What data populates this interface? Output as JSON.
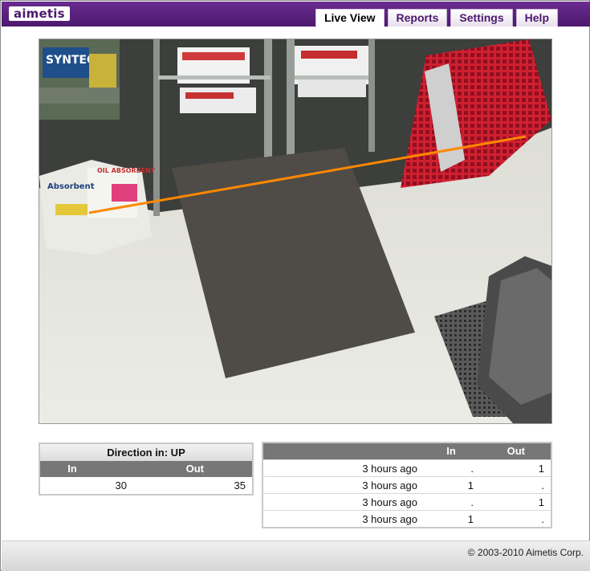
{
  "app": {
    "logo_text": "aimetis",
    "brand_color": "#4d1a6e"
  },
  "nav": {
    "tabs": [
      {
        "label": "Live View",
        "active": true
      },
      {
        "label": "Reports",
        "active": false
      },
      {
        "label": "Settings",
        "active": false
      },
      {
        "label": "Help",
        "active": false
      }
    ]
  },
  "camera": {
    "overlay_line_color": "#ff8800",
    "signage": {
      "syntec": "SYNTEC",
      "absorbent": "Absorbent",
      "oil_absorbent": "OIL ABSORBENT"
    }
  },
  "summary": {
    "title": "Direction in: UP",
    "headers": {
      "in": "In",
      "out": "Out"
    },
    "in_value": "30",
    "out_value": "35"
  },
  "events": {
    "headers": {
      "time": "",
      "in": "In",
      "out": "Out"
    },
    "rows": [
      {
        "time": "3 hours ago",
        "in": ".",
        "out": "1"
      },
      {
        "time": "3 hours ago",
        "in": "1",
        "out": "."
      },
      {
        "time": "3 hours ago",
        "in": ".",
        "out": "1"
      },
      {
        "time": "3 hours ago",
        "in": "1",
        "out": "."
      }
    ]
  },
  "footer": {
    "copyright": "© 2003-2010 Aimetis Corp."
  }
}
